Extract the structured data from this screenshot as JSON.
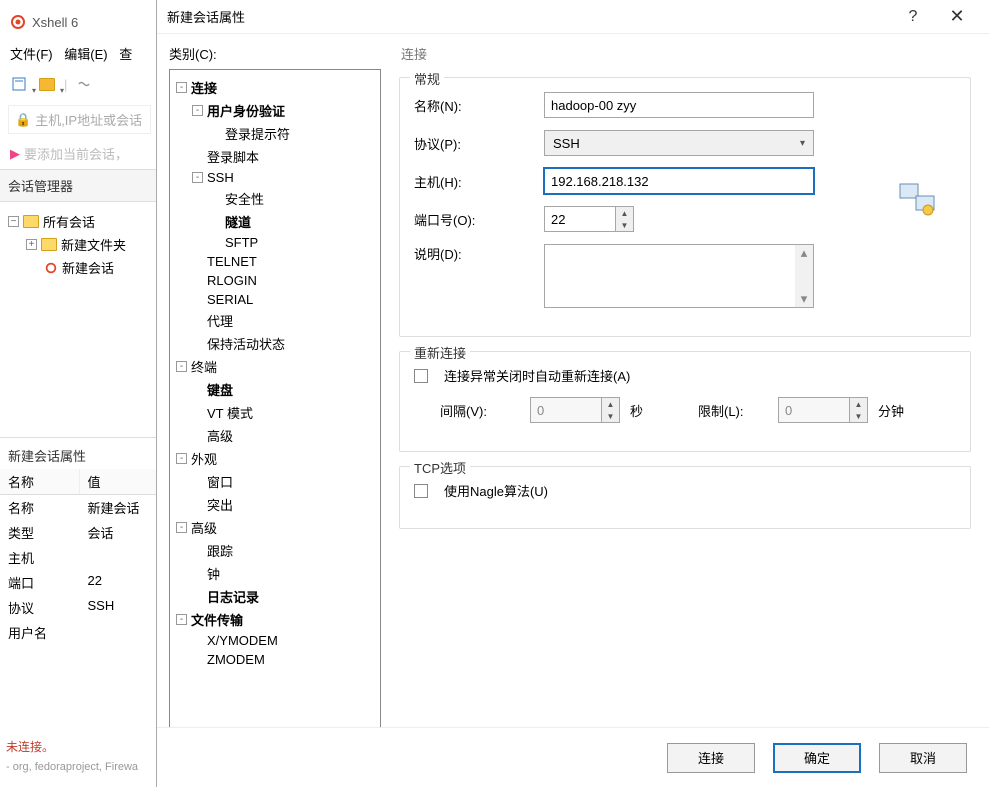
{
  "bg": {
    "app_title": "Xshell 6",
    "menu": {
      "file": "文件(F)",
      "edit": "编辑(E)",
      "view": "查"
    },
    "host_placeholder": "主机,IP地址或会话",
    "add_hint": "要添加当前会话，",
    "session_mgr": "会话管理器",
    "tree": {
      "root": "所有会话",
      "folder": "新建文件夹",
      "session": "新建会话"
    },
    "props_title": "新建会话属性",
    "props_head_name": "名称",
    "props_head_value": "值",
    "rows": [
      {
        "k": "名称",
        "v": "新建会话"
      },
      {
        "k": "类型",
        "v": "会话"
      },
      {
        "k": "主机",
        "v": ""
      },
      {
        "k": "端口",
        "v": "22"
      },
      {
        "k": "协议",
        "v": "SSH"
      },
      {
        "k": "用户名",
        "v": ""
      }
    ],
    "status": "未连接。",
    "footer": "- org, fedoraproject, Firewa"
  },
  "dialog": {
    "title": "新建会话属性",
    "help": "?",
    "close": "✕",
    "category_label": "类别(C):",
    "tree": [
      {
        "l": 0,
        "bold": true,
        "exp": "-",
        "label": "连接"
      },
      {
        "l": 1,
        "bold": true,
        "exp": "-",
        "label": "用户身份验证"
      },
      {
        "l": 2,
        "bold": false,
        "exp": "",
        "label": "登录提示符"
      },
      {
        "l": 1,
        "bold": false,
        "exp": "",
        "label": "登录脚本"
      },
      {
        "l": 1,
        "bold": false,
        "exp": "-",
        "label": "SSH"
      },
      {
        "l": 2,
        "bold": false,
        "exp": "",
        "label": "安全性"
      },
      {
        "l": 2,
        "bold": true,
        "exp": "",
        "label": "隧道"
      },
      {
        "l": 2,
        "bold": false,
        "exp": "",
        "label": "SFTP"
      },
      {
        "l": 1,
        "bold": false,
        "exp": "",
        "label": "TELNET"
      },
      {
        "l": 1,
        "bold": false,
        "exp": "",
        "label": "RLOGIN"
      },
      {
        "l": 1,
        "bold": false,
        "exp": "",
        "label": "SERIAL"
      },
      {
        "l": 1,
        "bold": false,
        "exp": "",
        "label": "代理"
      },
      {
        "l": 1,
        "bold": false,
        "exp": "",
        "label": "保持活动状态"
      },
      {
        "l": 0,
        "bold": false,
        "exp": "-",
        "label": "终端"
      },
      {
        "l": 1,
        "bold": true,
        "exp": "",
        "label": "键盘"
      },
      {
        "l": 1,
        "bold": false,
        "exp": "",
        "label": "VT 模式"
      },
      {
        "l": 1,
        "bold": false,
        "exp": "",
        "label": "高级"
      },
      {
        "l": 0,
        "bold": false,
        "exp": "-",
        "label": "外观"
      },
      {
        "l": 1,
        "bold": false,
        "exp": "",
        "label": "窗口"
      },
      {
        "l": 1,
        "bold": false,
        "exp": "",
        "label": "突出"
      },
      {
        "l": 0,
        "bold": false,
        "exp": "-",
        "label": "高级"
      },
      {
        "l": 1,
        "bold": false,
        "exp": "",
        "label": "跟踪"
      },
      {
        "l": 1,
        "bold": false,
        "exp": "",
        "label": "钟"
      },
      {
        "l": 1,
        "bold": true,
        "exp": "",
        "label": "日志记录"
      },
      {
        "l": 0,
        "bold": true,
        "exp": "-",
        "label": "文件传输"
      },
      {
        "l": 1,
        "bold": false,
        "exp": "",
        "label": "X/YMODEM"
      },
      {
        "l": 1,
        "bold": false,
        "exp": "",
        "label": "ZMODEM"
      }
    ],
    "form": {
      "section_title": "连接",
      "general_group": "常规",
      "name_label": "名称(N):",
      "name_value": "hadoop-00 zyy",
      "protocol_label": "协议(P):",
      "protocol_value": "SSH",
      "host_label": "主机(H):",
      "host_value": "192.168.218.132",
      "port_label": "端口号(O):",
      "port_value": "22",
      "desc_label": "说明(D):",
      "reconnect_group": "重新连接",
      "reconnect_check": "连接异常关闭时自动重新连接(A)",
      "interval_label": "间隔(V):",
      "interval_value": "0",
      "seconds": "秒",
      "limit_label": "限制(L):",
      "limit_value": "0",
      "minutes": "分钟",
      "tcp_group": "TCP选项",
      "nagle_check": "使用Nagle算法(U)"
    },
    "buttons": {
      "connect": "连接",
      "ok": "确定",
      "cancel": "取消"
    }
  }
}
